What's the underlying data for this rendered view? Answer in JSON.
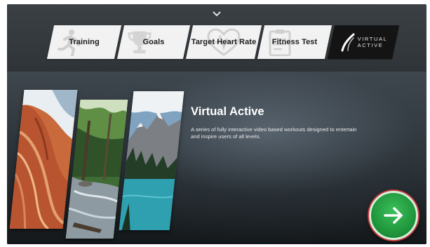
{
  "menu": {
    "tabs": [
      {
        "label": "Training",
        "icon": "runner-icon"
      },
      {
        "label": "Goals",
        "icon": "trophy-icon"
      },
      {
        "label": "Target Heart Rate",
        "icon": "heart-rate-icon"
      },
      {
        "label": "Fitness Test",
        "icon": "clipboard-icon"
      },
      {
        "label_line1": "VIRTUAL",
        "label_line2": "ACTIVE",
        "icon": "virtual-active-logo",
        "active": true
      }
    ]
  },
  "main": {
    "title": "Virtual Active",
    "description": "A series of fully interactive video based workouts designed to entertain and inspire users of all levels."
  },
  "colors": {
    "accent_green": "#21973d",
    "active_tab": "#141414",
    "tab": "#f2f2f2"
  }
}
